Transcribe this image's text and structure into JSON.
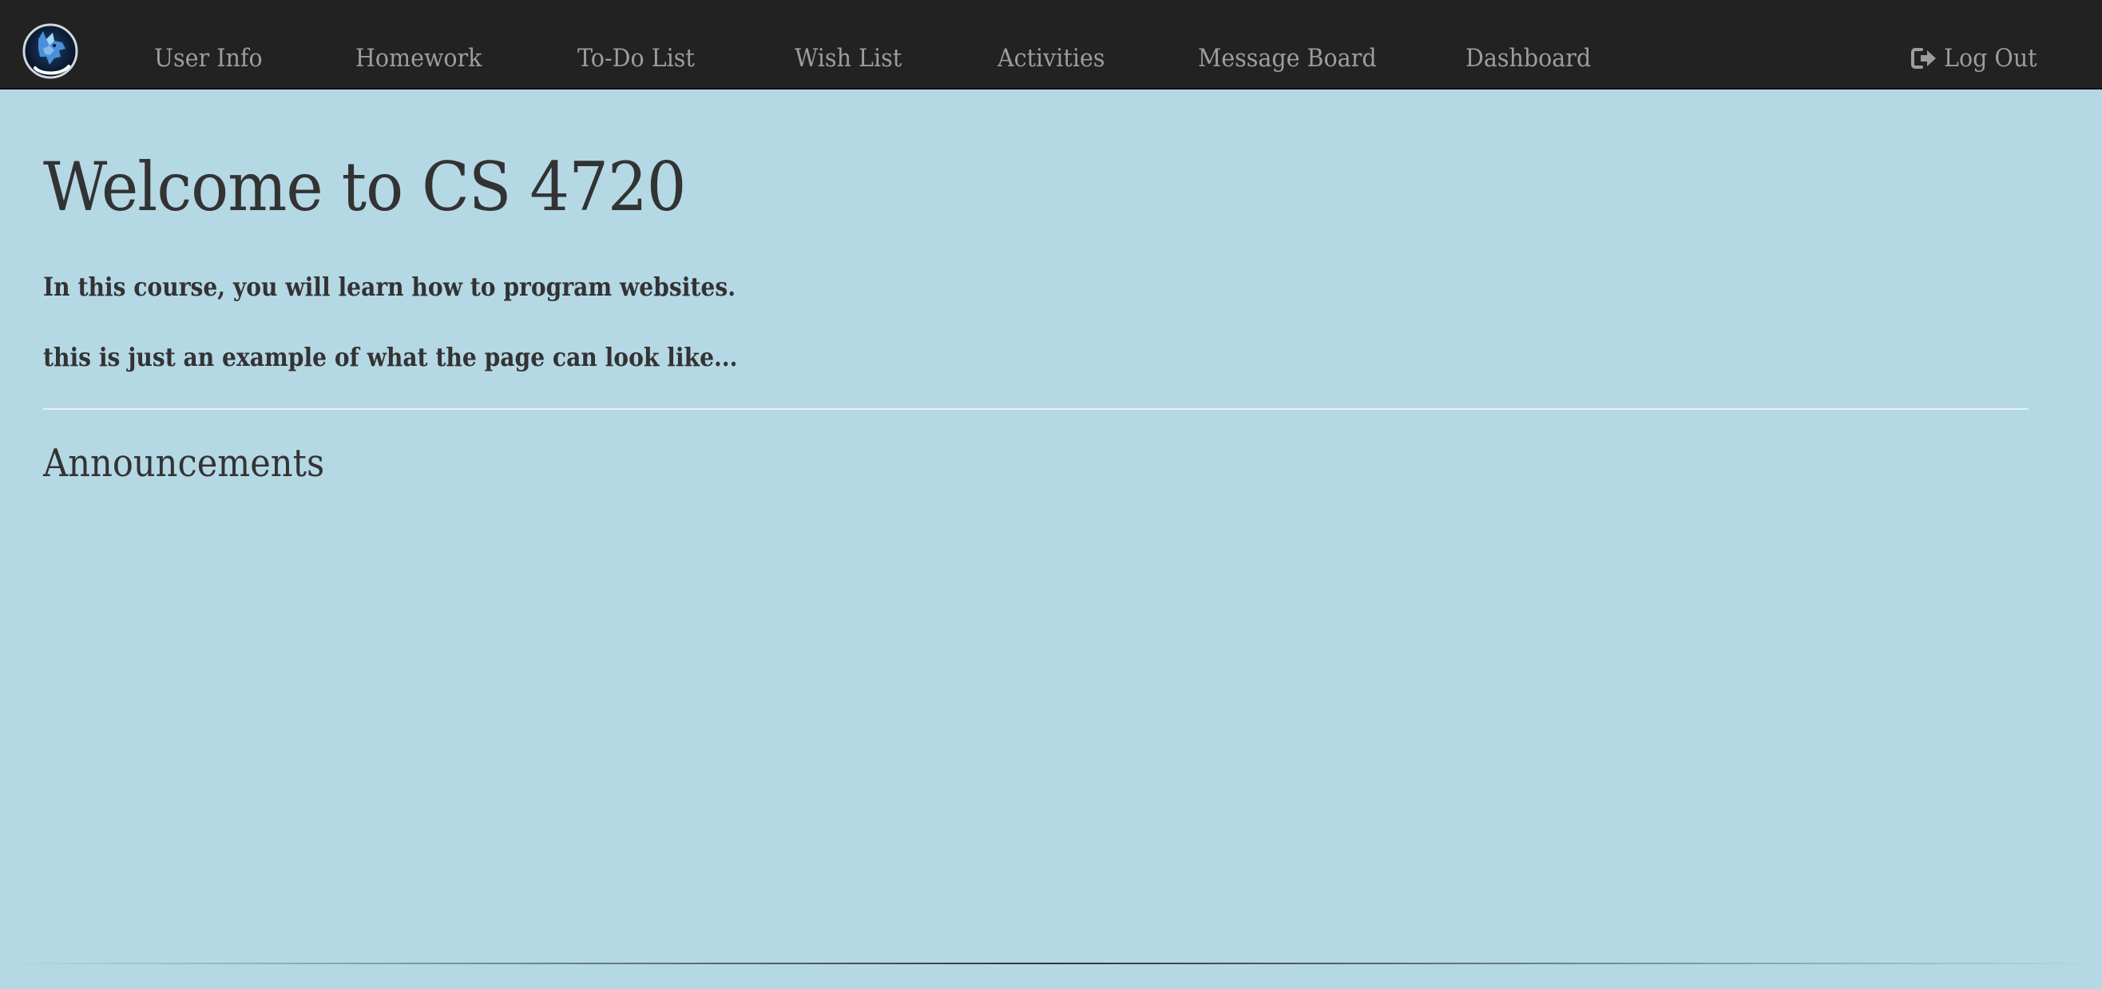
{
  "navbar": {
    "brand_icon": "wolf-logo-icon",
    "links": [
      {
        "label": "User Info"
      },
      {
        "label": "Homework"
      },
      {
        "label": "To-Do List"
      },
      {
        "label": "Wish List"
      },
      {
        "label": "Activities"
      },
      {
        "label": "Message Board"
      },
      {
        "label": "Dashboard"
      }
    ],
    "logout": {
      "label": "Log Out",
      "icon": "sign-out-icon"
    }
  },
  "main": {
    "title": "Welcome to CS 4720",
    "intro_lines": [
      "In this course, you will learn how to program websites.",
      "this is just an example of what the page can look like..."
    ],
    "announcements_heading": "Announcements"
  },
  "colors": {
    "page_background": "#b5d8e5",
    "navbar_background": "#222222",
    "nav_text": "#9d9d9d",
    "body_text": "#333333",
    "divider": "#eaf4f8"
  }
}
